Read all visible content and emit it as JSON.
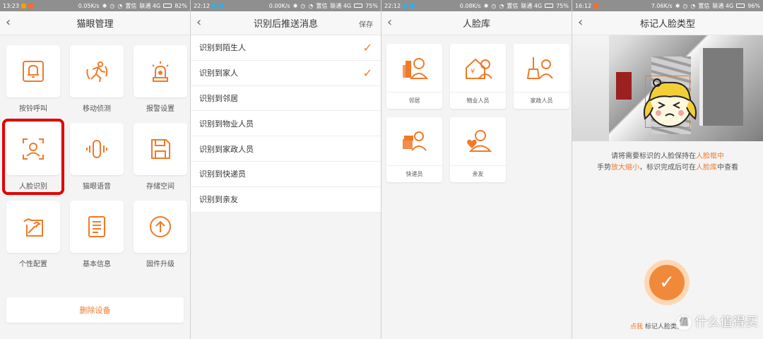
{
  "screens": [
    {
      "status": {
        "time": "13:23",
        "speed": "0.05K/s",
        "network": "置信",
        "carrier": "联通 4G",
        "battery": "82%"
      },
      "title": "猫眼管理",
      "tiles": [
        {
          "label": "按铃呼叫",
          "icon": "bell-icon"
        },
        {
          "label": "移动侦测",
          "icon": "running-person-icon"
        },
        {
          "label": "报警设置",
          "icon": "alarm-light-icon"
        },
        {
          "label": "人脸识别",
          "icon": "face-scan-icon",
          "selected": true
        },
        {
          "label": "猫眼语音",
          "icon": "voice-icon"
        },
        {
          "label": "存储空间",
          "icon": "storage-icon"
        },
        {
          "label": "个性配置",
          "icon": "wrench-icon"
        },
        {
          "label": "基本信息",
          "icon": "document-icon"
        },
        {
          "label": "固件升级",
          "icon": "upgrade-icon"
        }
      ],
      "delete_label": "删除设备"
    },
    {
      "status": {
        "time": "22:12",
        "speed": "0.00K/s",
        "network": "置信",
        "carrier": "联通 4G",
        "battery": "75%"
      },
      "title": "识别后推送消息",
      "action": "保存",
      "rows": [
        {
          "label": "识别到陌生人",
          "checked": true
        },
        {
          "label": "识别到家人",
          "checked": true
        },
        {
          "label": "识别到邻居",
          "checked": false
        },
        {
          "label": "识别到物业人员",
          "checked": false
        },
        {
          "label": "识别到家政人员",
          "checked": false
        },
        {
          "label": "识别到快递员",
          "checked": false
        },
        {
          "label": "识别到亲友",
          "checked": false
        }
      ]
    },
    {
      "status": {
        "time": "22:12",
        "speed": "0.08K/s",
        "network": "置信",
        "carrier": "联通 4G",
        "battery": "75%"
      },
      "title": "人脸库",
      "faces": [
        {
          "label": "邻居",
          "icon": "neighbor-icon"
        },
        {
          "label": "物业人员",
          "icon": "property-staff-icon"
        },
        {
          "label": "家政人员",
          "icon": "housekeeper-icon"
        },
        {
          "label": "快递员",
          "icon": "courier-icon"
        },
        {
          "label": "亲友",
          "icon": "friend-icon"
        }
      ]
    },
    {
      "status": {
        "time": "16:12",
        "speed": "7.06K/s",
        "network": "置信",
        "carrier": "联通 4G",
        "battery": "96%"
      },
      "title": "标记人脸类型",
      "hint_line1_prefix": "请将需要标识的人脸保持在",
      "hint_line1_highlight": "人脸框中",
      "hint_line2_prefix": "手势",
      "hint_line2_highlight": "放大缩小",
      "hint_line2_middle": "，标识完成后可在",
      "hint_line2_highlight2": "人脸库",
      "hint_line2_suffix": "中查看",
      "bottom_link": "点我",
      "bottom_text": "标记人脸类型",
      "watermark": "什么值得买",
      "watermark_badge": "值"
    }
  ],
  "colors": {
    "accent": "#f07a28",
    "selected_outline": "#e10000",
    "status_bar": "#8f8f8f"
  }
}
